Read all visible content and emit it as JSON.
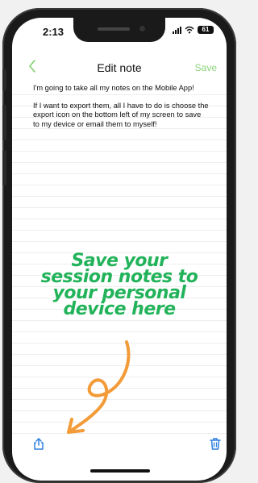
{
  "status_bar": {
    "time": "2:13",
    "battery": "61"
  },
  "nav": {
    "title": "Edit note",
    "save_label": "Save",
    "back_icon": "chevron-left-icon"
  },
  "note": {
    "paragraphs": [
      "I'm going to take all my notes on the Mobile App!",
      "If I want to export them, all I have to do is choose the export icon on the bottom left of my screen to save to my device or email them to myself!"
    ]
  },
  "promo": {
    "lines": [
      "Save your",
      "session notes to",
      "your personal",
      "device here"
    ]
  },
  "toolbar": {
    "export_icon": "share-icon",
    "delete_icon": "trash-icon"
  },
  "colors": {
    "accent": "#7ed26a",
    "promo_text": "#22b35a",
    "arrow": "#f29b38",
    "icon_blue": "#2f7fe0"
  }
}
